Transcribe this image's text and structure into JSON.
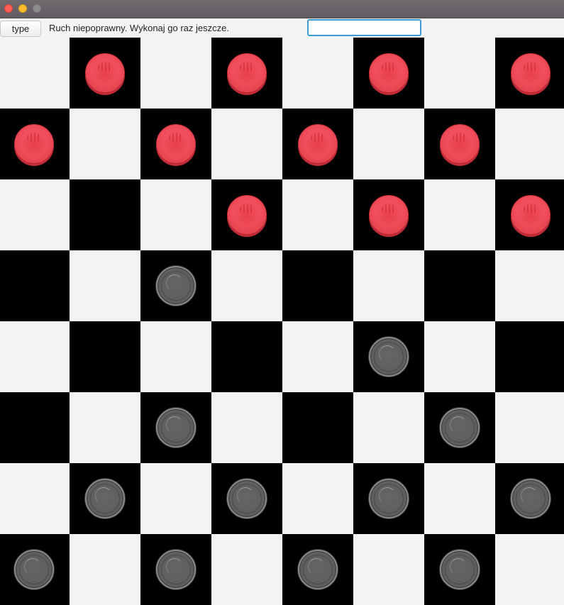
{
  "toolbar": {
    "type_button_label": "type",
    "status_message": "Ruch niepoprawny. Wykonaj go raz jeszcze.",
    "move_input_value": ""
  },
  "colors": {
    "light_square": "#f4f4f4",
    "dark_square": "#000000",
    "red_piece": "#ee4b57",
    "gray_piece": "#5e5e5e",
    "input_focus": "#3d9bd6"
  },
  "board": {
    "size": 8,
    "rows": [
      "-r-r-r-r",
      "r-r-r-r-",
      "---r-r-r",
      "--g-----",
      "-----g--",
      "--g---g-",
      "-g-g-g-g",
      "g-g-g-g-"
    ],
    "piece_legend": {
      "r": "red",
      "g": "gray",
      "-": "empty"
    }
  }
}
